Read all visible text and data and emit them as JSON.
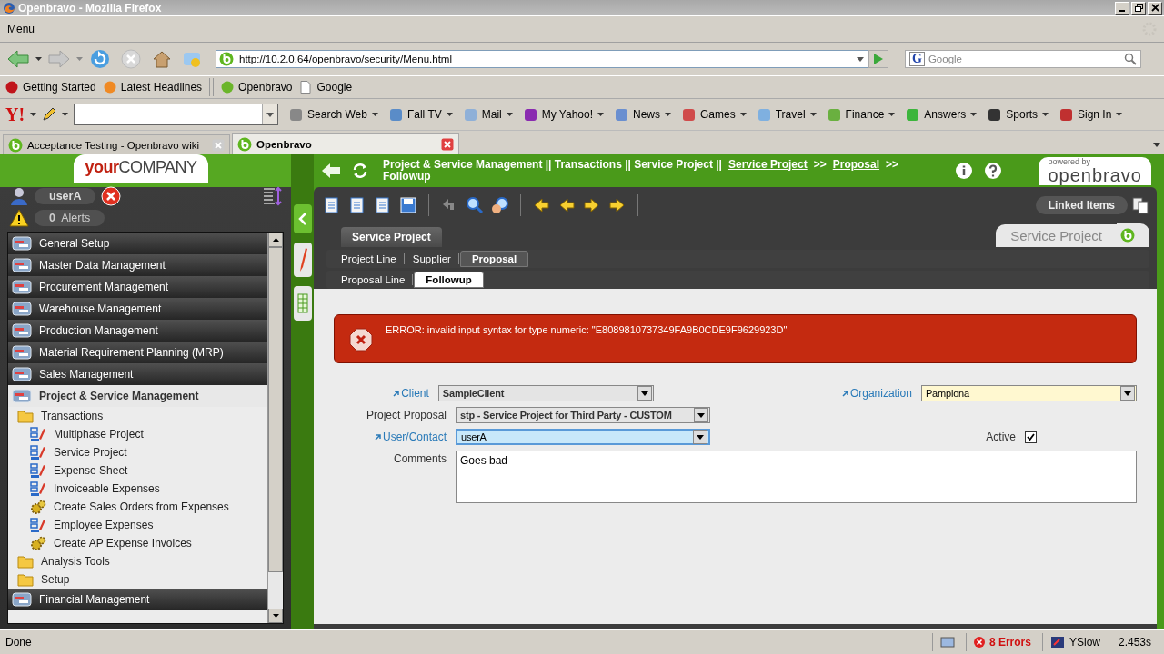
{
  "browser": {
    "title": "Openbravo - Mozilla Firefox",
    "menu": [
      "Menu"
    ],
    "url": "http://10.2.0.64/openbravo/security/Menu.html",
    "search_placeholder": "Google",
    "search_engine_logo": "G",
    "toolbar_logo": "Y!",
    "bookmarks": [
      {
        "label": "Getting Started",
        "kind": "hat"
      },
      {
        "label": "Latest Headlines",
        "kind": "feed"
      },
      {
        "label": "Openbravo",
        "kind": "site"
      },
      {
        "label": "Google",
        "kind": "page"
      }
    ],
    "yahoo_items": [
      {
        "label": "Search Web",
        "kind": "search"
      },
      {
        "label": "Fall TV",
        "kind": "tv"
      },
      {
        "label": "Mail",
        "kind": "mail"
      },
      {
        "label": "My Yahoo!",
        "kind": "my"
      },
      {
        "label": "News",
        "kind": "news"
      },
      {
        "label": "Games",
        "kind": "games"
      },
      {
        "label": "Travel",
        "kind": "travel"
      },
      {
        "label": "Finance",
        "kind": "finance"
      },
      {
        "label": "Answers",
        "kind": "answers"
      },
      {
        "label": "Sports",
        "kind": "sports"
      },
      {
        "label": "Sign In",
        "kind": "signin"
      }
    ],
    "tabs": [
      {
        "label": "Acceptance Testing - Openbravo wiki",
        "selected": false
      },
      {
        "label": "Openbravo",
        "selected": true
      }
    ],
    "status": {
      "text": "Done",
      "errors": "8 Errors",
      "yslow": "YSlow",
      "time": "2.453s"
    }
  },
  "app": {
    "logo_first": "your",
    "logo_second": "COMPANY",
    "user": "userA",
    "alerts_count": "0",
    "alerts_label": "Alerts",
    "menu": [
      {
        "label": "General Setup",
        "kind": "section",
        "expanded": false
      },
      {
        "label": "Master Data Management",
        "kind": "section",
        "expanded": false
      },
      {
        "label": "Procurement Management",
        "kind": "section",
        "expanded": false
      },
      {
        "label": "Warehouse Management",
        "kind": "section",
        "expanded": false
      },
      {
        "label": "Production Management",
        "kind": "section",
        "expanded": false
      },
      {
        "label": "Material Requirement Planning (MRP)",
        "kind": "section",
        "expanded": false
      },
      {
        "label": "Sales Management",
        "kind": "section",
        "expanded": false
      },
      {
        "label": "Project & Service Management",
        "kind": "section",
        "expanded": true,
        "children": [
          {
            "label": "Transactions",
            "kind": "folder",
            "expanded": true,
            "children": [
              {
                "label": "Multiphase Project",
                "kind": "window"
              },
              {
                "label": "Service Project",
                "kind": "window"
              },
              {
                "label": "Expense Sheet",
                "kind": "window"
              },
              {
                "label": "Invoiceable Expenses",
                "kind": "window"
              },
              {
                "label": "Create Sales Orders from Expenses",
                "kind": "process"
              },
              {
                "label": "Employee Expenses",
                "kind": "window"
              },
              {
                "label": "Create AP Expense Invoices",
                "kind": "process"
              }
            ]
          },
          {
            "label": "Analysis Tools",
            "kind": "folder",
            "expanded": false
          },
          {
            "label": "Setup",
            "kind": "folder",
            "expanded": false
          }
        ]
      },
      {
        "label": "Financial Management",
        "kind": "section",
        "expanded": false
      }
    ],
    "breadcrumb": [
      {
        "text": "Project & Service Management || Transactions || Service Project ||",
        "kind": "plain"
      },
      {
        "text": "Service Project",
        "kind": "link"
      },
      {
        "text": ">>",
        "kind": "plain"
      },
      {
        "text": "Proposal",
        "kind": "link"
      },
      {
        "text": ">>",
        "kind": "plain"
      },
      {
        "text": "Followup",
        "kind": "plain"
      }
    ],
    "powered_by": "powered by",
    "brand": "openbravo",
    "linked_items": "Linked Items",
    "window_name": "Service Project",
    "tab_levels": [
      [
        {
          "label": "Service Project",
          "selected": true
        }
      ],
      [
        {
          "label": "Project Line",
          "selected": false
        },
        {
          "label": "Supplier",
          "selected": false
        },
        {
          "label": "Proposal",
          "selected": true
        }
      ],
      [
        {
          "label": "Proposal Line",
          "selected": false
        },
        {
          "label": "Followup",
          "selected": true
        }
      ]
    ],
    "error": "ERROR: invalid input syntax for type numeric: \"E8089810737349FA9B0CDE9F9629923D\"",
    "form": [
      [
        {
          "label": "Client",
          "kind": "select",
          "linked": true,
          "readonly": true,
          "required": false,
          "focused": false,
          "value": "SampleClient"
        },
        {
          "label": "Organization",
          "kind": "select",
          "linked": true,
          "readonly": false,
          "required": true,
          "focused": false,
          "value": "Pamplona"
        }
      ],
      [
        {
          "label": "Project Proposal",
          "kind": "select",
          "linked": false,
          "readonly": true,
          "required": false,
          "focused": false,
          "value": "stp - Service Project for Third Party - CUSTOM"
        }
      ],
      [
        {
          "label": "User/Contact",
          "kind": "select",
          "linked": true,
          "readonly": false,
          "required": false,
          "focused": true,
          "value": "userA"
        },
        {
          "label": "Active",
          "kind": "checkbox",
          "linked": false,
          "checked": true
        }
      ],
      [
        {
          "label": "Comments",
          "kind": "textarea",
          "linked": false,
          "value": "Goes bad"
        }
      ]
    ]
  }
}
